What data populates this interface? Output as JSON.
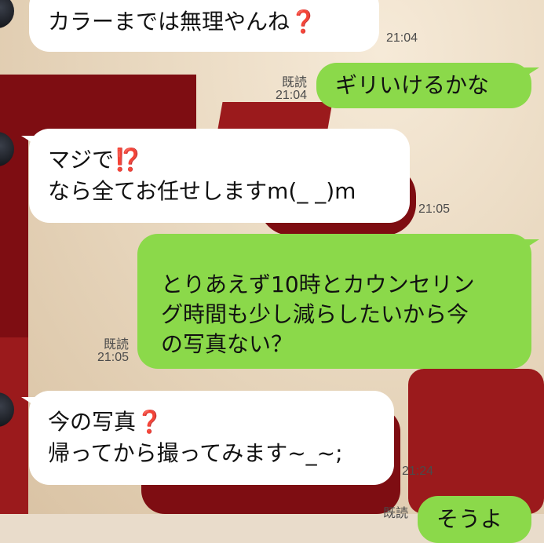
{
  "messages": [
    {
      "side": "in",
      "lines": [
        "カラーまでは無理やんね",
        "❓"
      ],
      "time": "21:04"
    },
    {
      "side": "out",
      "lines": [
        "ギリいけるかな"
      ],
      "read": "既読",
      "time": "21:04"
    },
    {
      "side": "in",
      "lines": [
        "マジで",
        "⁉️",
        "なら全てお任せしますm(_ _)m"
      ],
      "time": "21:05"
    },
    {
      "side": "out",
      "lines": [
        "とりあえず10時とカウンセリン",
        "グ時間も少し減らしたいから今",
        "の写真ない？"
      ],
      "read": "既読",
      "time": "21:05"
    },
    {
      "side": "in",
      "lines": [
        "今の写真",
        "❓",
        "帰ってから撮ってみます~_~;"
      ],
      "time": "21:24"
    },
    {
      "side": "out",
      "lines": [
        "そうよ"
      ],
      "read": "既読"
    }
  ],
  "colors": {
    "incoming": "#ffffff",
    "outgoing": "#8bd94a",
    "accent_red": "#e0281c"
  }
}
